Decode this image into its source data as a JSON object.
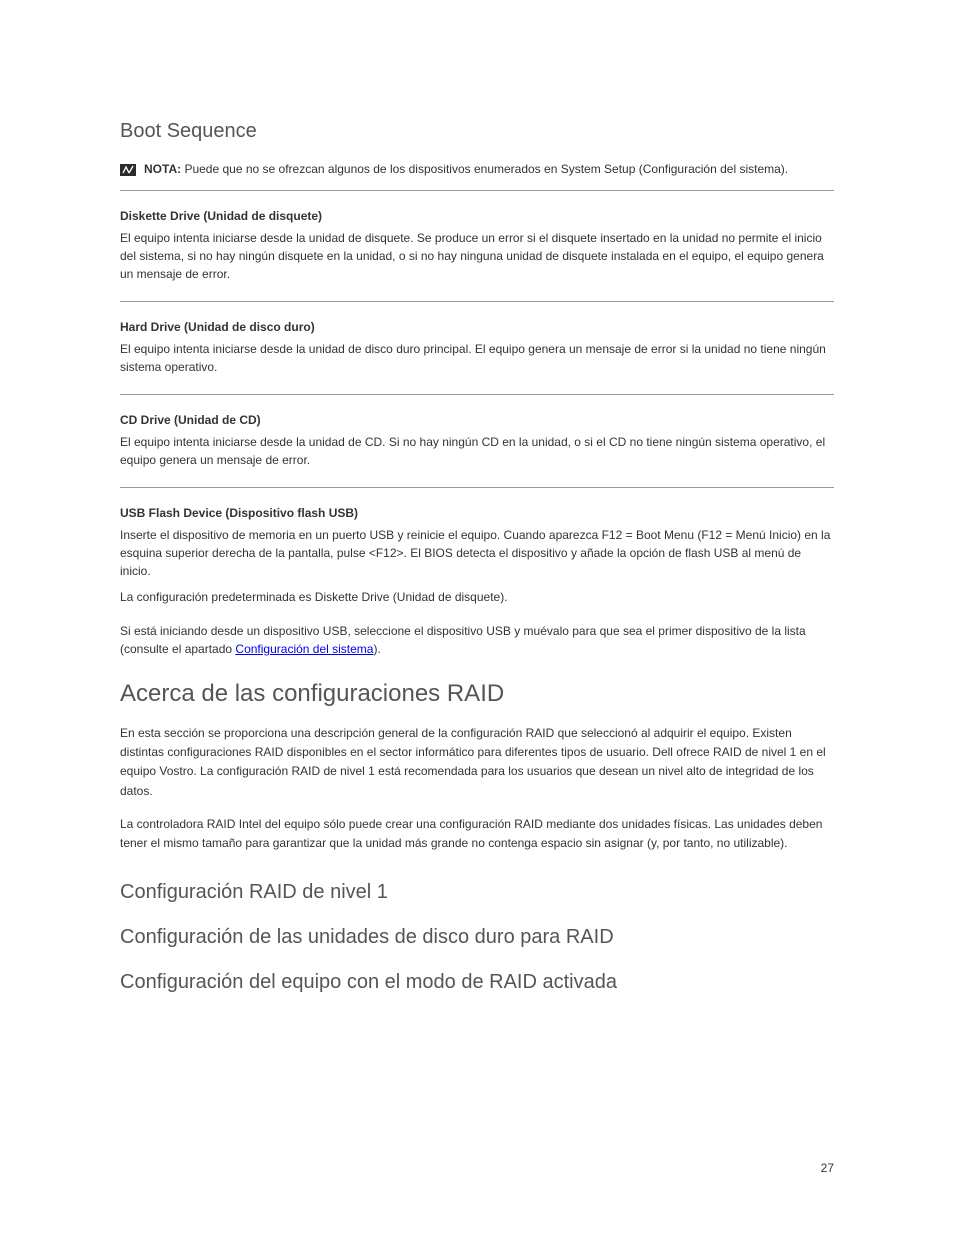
{
  "heading_boot_sequence": "Boot Sequence",
  "note": {
    "label": "NOTA:",
    "text": "Puede que no se ofrezcan algunos de los dispositivos enumerados en System Setup (Configuración del sistema)."
  },
  "options": [
    {
      "name": "Diskette Drive (Unidad de disquete)",
      "desc": "El equipo intenta iniciarse desde la unidad de disquete. Se produce un error si el disquete insertado en la unidad no permite el inicio del sistema, si no hay ningún disquete en la unidad, o si no hay ninguna unidad de disquete instalada en el equipo, el equipo genera un mensaje de error."
    },
    {
      "name": "Hard Drive (Unidad de disco duro)",
      "desc": "El equipo intenta iniciarse desde la unidad de disco duro principal. El equipo genera un mensaje de error si la unidad no tiene ningún sistema operativo."
    },
    {
      "name": "CD Drive (Unidad de CD)",
      "desc": "El equipo intenta iniciarse desde la unidad de CD. Si no hay ningún CD en la unidad, o si el CD no tiene ningún sistema operativo, el equipo genera un mensaje de error."
    },
    {
      "name": "USB Flash Device (Dispositivo flash USB)",
      "desc": "Inserte el dispositivo de memoria en un puerto USB y reinicie el equipo. Cuando aparezca F12 = Boot Menu (F12 = Menú Inicio) en la esquina superior derecha de la pantalla, pulse <F12>. El BIOS detecta el dispositivo y añade la opción de flash USB al menú de inicio.",
      "default": "La configuración predeterminada es Diskette Drive (Unidad de disquete)."
    }
  ],
  "after_text_prefix": "Si está iniciando desde un dispositivo USB, seleccione el dispositivo USB y muévalo para que sea el primer dispositivo de la lista (consulte el apartado ",
  "after_text_link": "Configuración del sistema",
  "after_text_suffix": ").",
  "body_heading": "Acerca de las configuraciones RAID",
  "body_paras": [
    "En esta sección se proporciona una descripción general de la configuración RAID que seleccionó al adquirir el equipo. Existen distintas configuraciones RAID disponibles en el sector informático para diferentes tipos de usuario. Dell ofrece RAID de nivel 1 en el equipo Vostro. La configuración RAID de nivel 1 está recomendada para los usuarios que desean un nivel alto de integridad de los datos.",
    "La controladora RAID Intel del equipo sólo puede crear una configuración RAID mediante dos unidades físicas. Las unidades deben tener el mismo tamaño para garantizar que la unidad más grande no contenga espacio sin asignar (y, por tanto, no utilizable)."
  ],
  "stubs": [
    "Configuración RAID de nivel 1",
    "Configuración de las unidades de disco duro para RAID",
    "Configuración del equipo con el modo de RAID activada"
  ],
  "page_number": "27"
}
